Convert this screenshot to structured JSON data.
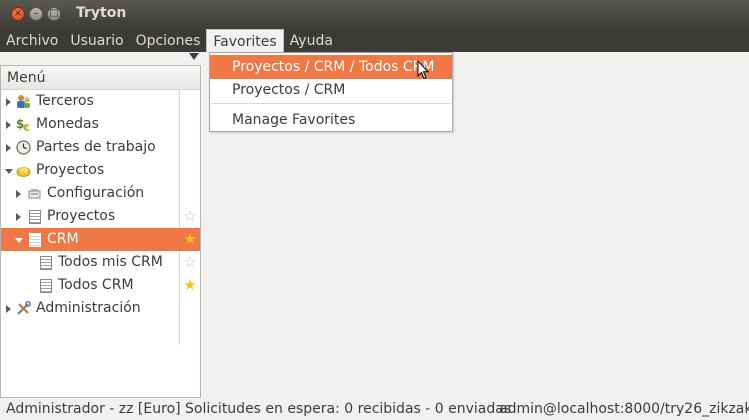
{
  "window": {
    "title": "Tryton",
    "close_glyph": "×",
    "minimize_glyph": "–",
    "maximize_glyph": "□"
  },
  "menubar": [
    {
      "label": "Archivo"
    },
    {
      "label": "Usuario"
    },
    {
      "label": "Opciones"
    },
    {
      "label": "Favorites"
    },
    {
      "label": "Ayuda"
    }
  ],
  "tree": {
    "header": "Menú",
    "rows": [
      {
        "label": "Terceros",
        "icon": "users-icon",
        "state": "collapsed",
        "level": 0
      },
      {
        "label": "Monedas",
        "icon": "currency-icon",
        "state": "collapsed",
        "level": 0
      },
      {
        "label": "Partes de trabajo",
        "icon": "clock-icon",
        "state": "collapsed",
        "level": 0
      },
      {
        "label": "Proyectos",
        "icon": "folder-icon",
        "state": "expanded",
        "level": 0
      },
      {
        "label": "Configuración",
        "icon": "config-icon",
        "state": "collapsed",
        "level": 1
      },
      {
        "label": "Proyectos",
        "icon": "document-icon",
        "state": "collapsed",
        "level": 1,
        "favorite": false
      },
      {
        "label": "CRM",
        "icon": "document-icon",
        "state": "expanded",
        "level": 1,
        "favorite": true,
        "selected": true
      },
      {
        "label": "Todos mis CRM",
        "icon": "document-icon",
        "level": 2,
        "favorite": false
      },
      {
        "label": "Todos CRM",
        "icon": "document-icon",
        "level": 2,
        "favorite": true
      },
      {
        "label": "Administración",
        "icon": "tools-icon",
        "state": "collapsed",
        "level": 0
      }
    ]
  },
  "favorites_menu": {
    "items": [
      {
        "label": "Proyectos / CRM / Todos CRM"
      },
      {
        "label": "Proyectos / CRM"
      },
      {
        "label": "Manage Favorites"
      }
    ]
  },
  "statusbar": {
    "user": "Administrador - zz [Euro]",
    "requests": "Solicitudes en espera: 0 recibidas - 0 enviadas",
    "connection": "admin@localhost:8000/try26_zikzak"
  },
  "colors": {
    "accent": "#f07746",
    "titlebar": "#3c3b37",
    "star": "#f2c417"
  }
}
